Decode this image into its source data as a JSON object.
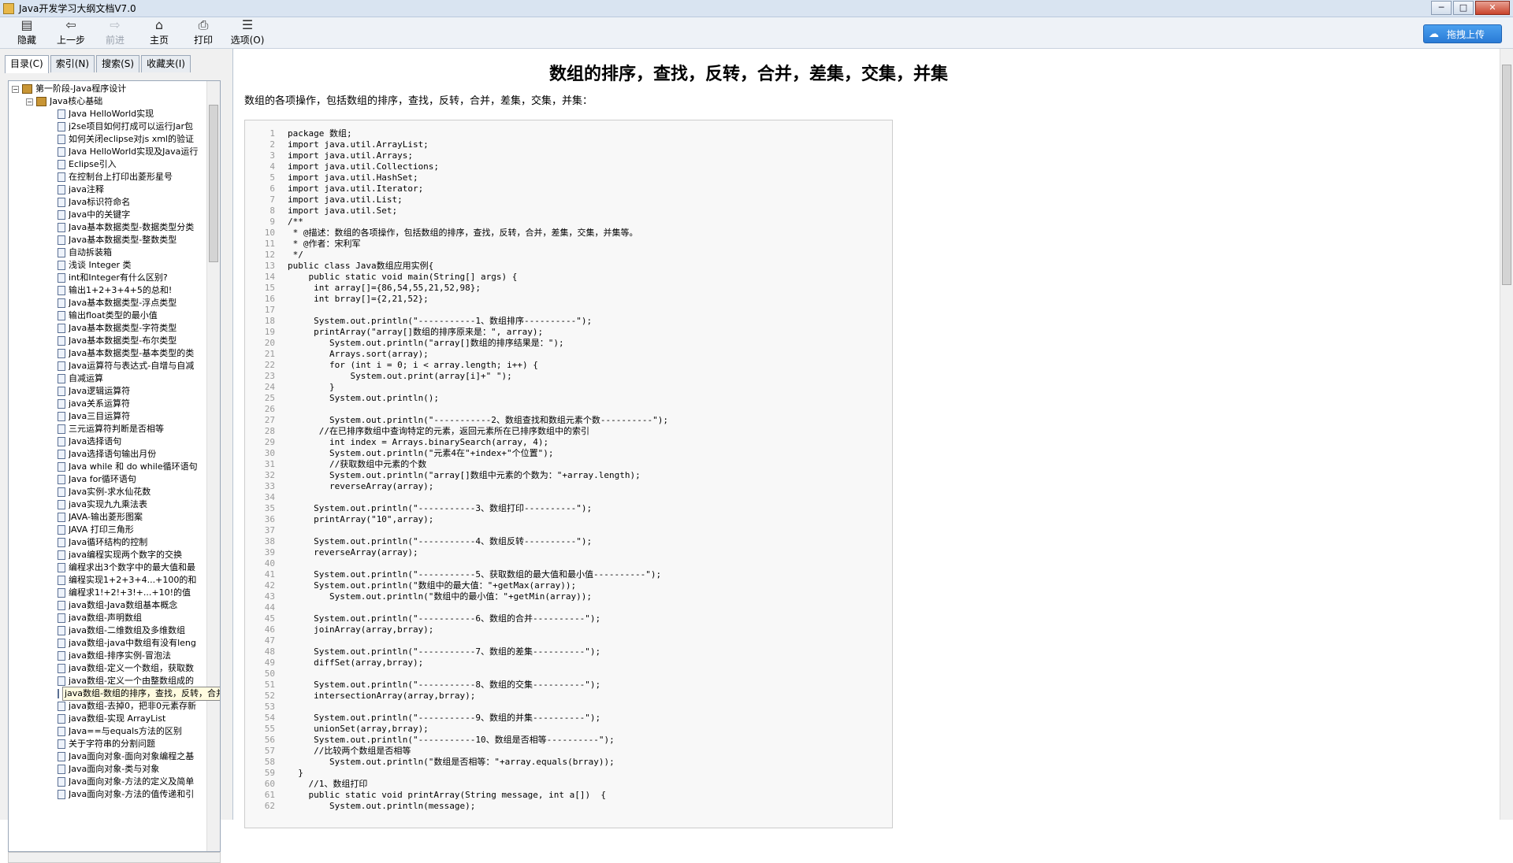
{
  "window": {
    "title": "Java开发学习大纲文档V7.0",
    "buttons": {
      "minimize": "─",
      "maximize": "□",
      "close": "✕"
    }
  },
  "toolbar": {
    "items": [
      {
        "label": "隐藏",
        "icon": "hide-icon",
        "glyph": "▤"
      },
      {
        "label": "上一步",
        "icon": "back-icon",
        "glyph": "⇦"
      },
      {
        "label": "前进",
        "icon": "forward-icon",
        "glyph": "⇨"
      },
      {
        "label": "主页",
        "icon": "home-icon",
        "glyph": "⌂"
      },
      {
        "label": "打印",
        "icon": "print-icon",
        "glyph": "⎙"
      },
      {
        "label": "选项(O)",
        "icon": "options-icon",
        "glyph": "☰"
      }
    ],
    "upload_label": "拖拽上传"
  },
  "sidebar": {
    "tabs": [
      "目录(C)",
      "索引(N)",
      "搜索(S)",
      "收藏夹(I)"
    ],
    "root": "第一阶段-Java程序设计",
    "group": "Java核心基础",
    "items": [
      "Java HelloWorld实现",
      "j2se项目如何打成可以运行Jar包",
      "如何关闭eclipse对js xml的验证",
      "Java HelloWorld实现及Java运行",
      "Eclipse引入",
      "在控制台上打印出菱形星号",
      "java注释",
      "Java标识符命名",
      "Java中的关键字",
      "Java基本数据类型-数据类型分类",
      "Java基本数据类型-整数类型",
      "自动拆装箱",
      "浅谈 Integer 类",
      "int和Integer有什么区别?",
      "输出1+2+3+4+5的总和!",
      "Java基本数据类型-浮点类型",
      "输出float类型的最小值",
      "Java基本数据类型-字符类型",
      "Java基本数据类型-布尔类型",
      "Java基本数据类型-基本类型的类",
      "Java运算符与表达式-自增与自减",
      "自减运算",
      "Java逻辑运算符",
      "java关系运算符",
      "Java三目运算符",
      "三元运算符判断是否相等",
      "Java选择语句",
      "Java选择语句输出月份",
      "Java while 和 do while循环语句",
      "Java for循环语句",
      "Java实例-求水仙花数",
      "java实现九九乘法表",
      "JAVA-输出菱形图案",
      "JAVA 打印三角形",
      "Java循环结构的控制",
      "java编程实现两个数字的交换",
      "编程求出3个数字中的最大值和最",
      "编程实现1+2+3+4...+100的和",
      "编程求1!+2!+3!+...+10!的值",
      "java数组-Java数组基本概念",
      "java数组-声明数组",
      "java数组-二维数组及多维数组",
      "java数组-java中数组有没有leng",
      "java数组-排序实例-冒泡法",
      "java数组-定义一个数组，获取数",
      "java数组-定义一个由整数组成的",
      "java数组-数组的排序，查找，反转，合并，差集，交集，并集",
      "java数组-去掉0，把非0元素存新",
      "java数组-实现 ArrayList",
      "Java==与equals方法的区别",
      "关于字符串的分割问题",
      "Java面向对象-面向对象编程之基",
      "Java面向对象-类与对象",
      "Java面向对象-方法的定义及简单",
      "Java面向对象-方法的值传递和引"
    ],
    "selected_index": 46
  },
  "article": {
    "title": "数组的排序，查找，反转，合并，差集，交集，并集",
    "intro": "数组的各项操作，包括数组的排序，查找，反转，合并，差集，交集，并集：",
    "code_lines": [
      "package 数组;",
      "import java.util.ArrayList;",
      "import java.util.Arrays;",
      "import java.util.Collections;",
      "import java.util.HashSet;",
      "import java.util.Iterator;",
      "import java.util.List;",
      "import java.util.Set;",
      "/**",
      " * @描述：数组的各项操作，包括数组的排序，查找，反转，合并，差集，交集，并集等。",
      " * @作者：宋利军",
      " */",
      "public class Java数组应用实例{",
      "    public static void main(String[] args) {",
      "     int array[]={86,54,55,21,52,98};",
      "     int brray[]={2,21,52};",
      "",
      "     System.out.println(\"-----------1、数组排序----------\");",
      "     printArray(\"array[]数组的排序原来是：\", array);",
      "        System.out.println(\"array[]数组的排序结果是：\");",
      "        Arrays.sort(array);",
      "        for (int i = 0; i < array.length; i++) {",
      "            System.out.print(array[i]+\" \");",
      "        }",
      "        System.out.println();",
      "",
      "        System.out.println(\"-----------2、数组查找和数组元素个数----------\");",
      "      //在已排序数组中查询特定的元素，返回元素所在已排序数组中的索引",
      "        int index = Arrays.binarySearch(array, 4);",
      "        System.out.println(\"元素4在\"+index+\"个位置\");",
      "        //获取数组中元素的个数",
      "        System.out.println(\"array[]数组中元素的个数为：\"+array.length);",
      "        reverseArray(array);",
      "",
      "     System.out.println(\"-----------3、数组打印----------\");",
      "     printArray(\"10\",array);",
      "",
      "     System.out.println(\"-----------4、数组反转----------\");",
      "     reverseArray(array);",
      "",
      "     System.out.println(\"-----------5、获取数组的最大值和最小值----------\");",
      "     System.out.println(\"数组中的最大值：\"+getMax(array));",
      "        System.out.println(\"数组中的最小值：\"+getMin(array));",
      "",
      "     System.out.println(\"-----------6、数组的合并----------\");",
      "     joinArray(array,brray);",
      "",
      "     System.out.println(\"-----------7、数组的差集----------\");",
      "     diffSet(array,brray);",
      "",
      "     System.out.println(\"-----------8、数组的交集----------\");",
      "     intersectionArray(array,brray);",
      "",
      "     System.out.println(\"-----------9、数组的并集----------\");",
      "     unionSet(array,brray);",
      "     System.out.println(\"-----------10、数组是否相等----------\");",
      "     //比较两个数组是否相等",
      "        System.out.println(\"数组是否相等：\"+array.equals(brray));",
      "  }",
      "    //1、数组打印",
      "    public static void printArray(String message, int a[])  {",
      "        System.out.println(message);"
    ]
  }
}
